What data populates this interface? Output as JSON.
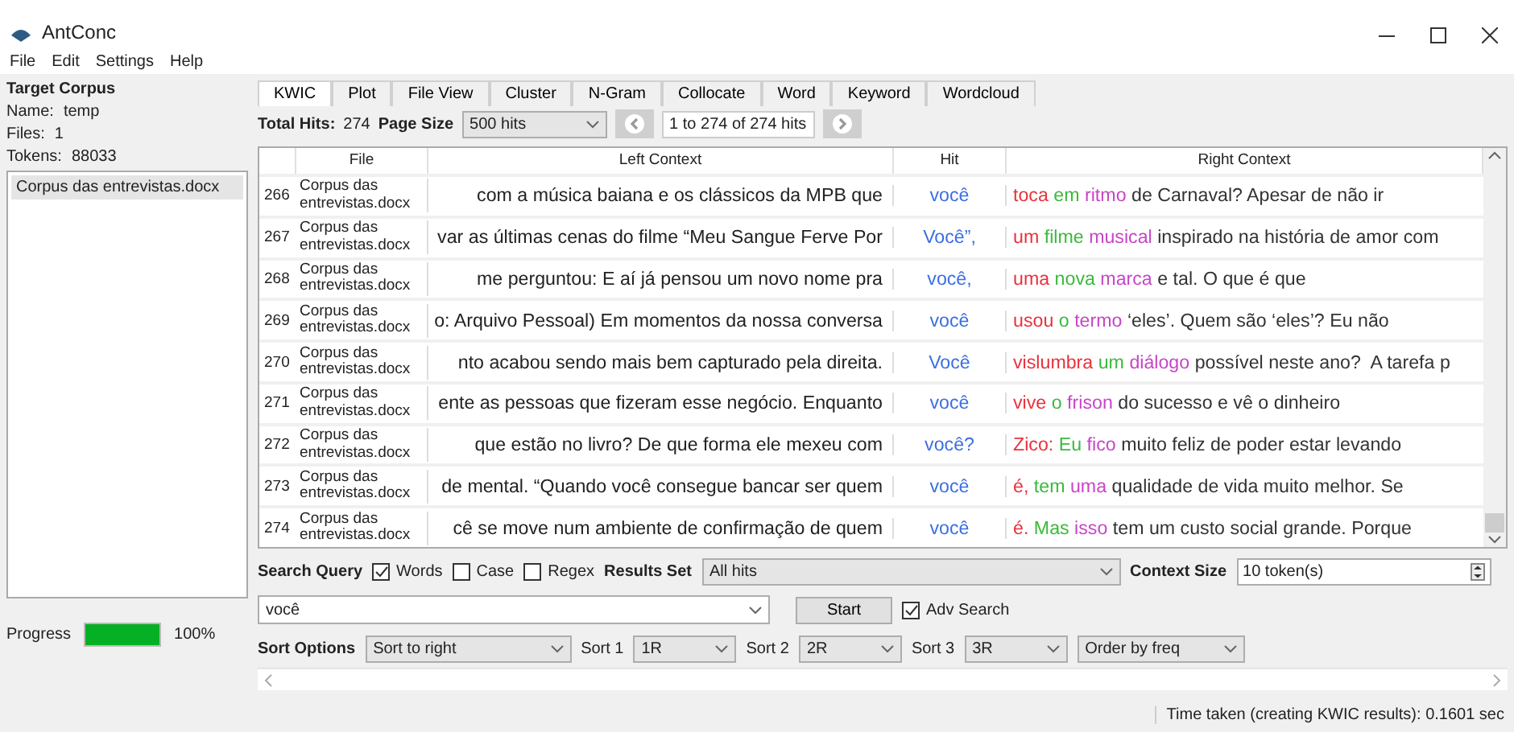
{
  "window": {
    "title": "AntConc"
  },
  "menu": [
    "File",
    "Edit",
    "Settings",
    "Help"
  ],
  "corpus": {
    "heading": "Target Corpus",
    "name_label": "Name:",
    "name": "temp",
    "files_label": "Files:",
    "files": "1",
    "tokens_label": "Tokens:",
    "tokens": "88033",
    "items": [
      {
        "label": "Corpus das entrevistas.docx",
        "selected": true
      }
    ],
    "progress_label": "Progress",
    "progress": {
      "level": 1,
      "reading": "100%"
    }
  },
  "tabs": [
    {
      "label": "KWIC",
      "selected": true
    },
    {
      "label": "Plot",
      "selected": false
    },
    {
      "label": "File View",
      "selected": false
    },
    {
      "label": "Cluster",
      "selected": false
    },
    {
      "label": "N-Gram",
      "selected": false
    },
    {
      "label": "Collocate",
      "selected": false
    },
    {
      "label": "Word",
      "selected": false
    },
    {
      "label": "Keyword",
      "selected": false
    },
    {
      "label": "Wordcloud",
      "selected": false
    }
  ],
  "toolbar": {
    "hits_label": "Total Hits:",
    "hits": "274",
    "page_size_label": "Page Size",
    "page_size": "500 hits",
    "pager": "1 to 274 of 274 hits"
  },
  "table": {
    "columns": [
      "File",
      "Left Context",
      "Hit",
      "Right Context"
    ],
    "rows": [
      {
        "n": "266",
        "file": "Corpus das entrevistas.docx",
        "left": "com a música baiana e os clássicos da MPB que",
        "hit": "você",
        "right": [
          {
            "text": "toca",
            "color": "#e8323c"
          },
          {
            "text": "em",
            "color": "#3cb93c"
          },
          {
            "text": "ritmo",
            "color": "#c845c8"
          },
          {
            "text": "de Carnaval? Apesar de não ir",
            "color": "#333333"
          }
        ]
      },
      {
        "n": "267",
        "file": "Corpus das entrevistas.docx",
        "left": "var as últimas cenas do filme “Meu Sangue Ferve Por",
        "hit": "Você”,",
        "right": [
          {
            "text": "um",
            "color": "#e8323c"
          },
          {
            "text": "filme",
            "color": "#3cb93c"
          },
          {
            "text": "musical",
            "color": "#c845c8"
          },
          {
            "text": "inspirado na história de amor com",
            "color": "#333333"
          }
        ]
      },
      {
        "n": "268",
        "file": "Corpus das entrevistas.docx",
        "left": "me perguntou: E aí já pensou um novo nome pra",
        "hit": "você,",
        "right": [
          {
            "text": "uma",
            "color": "#e8323c"
          },
          {
            "text": "nova",
            "color": "#3cb93c"
          },
          {
            "text": "marca",
            "color": "#c845c8"
          },
          {
            "text": "e tal. O que é que",
            "color": "#333333"
          }
        ]
      },
      {
        "n": "269",
        "file": "Corpus das entrevistas.docx",
        "left": "o: Arquivo Pessoal) Em momentos da nossa conversa",
        "hit": "você",
        "right": [
          {
            "text": "usou",
            "color": "#e8323c"
          },
          {
            "text": "o",
            "color": "#3cb93c"
          },
          {
            "text": "termo",
            "color": "#c845c8"
          },
          {
            "text": "‘eles’. Quem são ‘eles’? Eu não",
            "color": "#333333"
          }
        ]
      },
      {
        "n": "270",
        "file": "Corpus das entrevistas.docx",
        "left": "nto acabou sendo mais bem capturado pela direita.",
        "hit": "Você",
        "right": [
          {
            "text": "vislumbra",
            "color": "#e8323c"
          },
          {
            "text": "um",
            "color": "#3cb93c"
          },
          {
            "text": "diálogo",
            "color": "#c845c8"
          },
          {
            "text": "possível neste ano?  A tarefa p",
            "color": "#333333"
          }
        ]
      },
      {
        "n": "271",
        "file": "Corpus das entrevistas.docx",
        "left": "ente as pessoas que fizeram esse negócio. Enquanto",
        "hit": "você",
        "right": [
          {
            "text": "vive",
            "color": "#e8323c"
          },
          {
            "text": "o",
            "color": "#3cb93c"
          },
          {
            "text": "frison",
            "color": "#c845c8"
          },
          {
            "text": "do sucesso e vê o dinheiro",
            "color": "#333333"
          }
        ]
      },
      {
        "n": "272",
        "file": "Corpus das entrevistas.docx",
        "left": "que estão no livro? De que forma ele mexeu com",
        "hit": "você?",
        "right": [
          {
            "text": "Zico:",
            "color": "#e8323c"
          },
          {
            "text": "Eu",
            "color": "#3cb93c"
          },
          {
            "text": "fico",
            "color": "#c845c8"
          },
          {
            "text": "muito feliz de poder estar levando",
            "color": "#333333"
          }
        ]
      },
      {
        "n": "273",
        "file": "Corpus das entrevistas.docx",
        "left": "de mental. “Quando você consegue bancar ser quem",
        "hit": "você",
        "right": [
          {
            "text": "é,",
            "color": "#e8323c"
          },
          {
            "text": "tem",
            "color": "#3cb93c"
          },
          {
            "text": "uma",
            "color": "#c845c8"
          },
          {
            "text": "qualidade de vida muito melhor. Se",
            "color": "#333333"
          }
        ]
      },
      {
        "n": "274",
        "file": "Corpus das entrevistas.docx",
        "left": "cê se move num ambiente de confirmação de quem",
        "hit": "você",
        "right": [
          {
            "text": "é.",
            "color": "#e8323c"
          },
          {
            "text": "Mas",
            "color": "#3cb93c"
          },
          {
            "text": "isso",
            "color": "#c845c8"
          },
          {
            "text": "tem um custo social grande. Porque",
            "color": "#333333"
          }
        ]
      }
    ]
  },
  "search": {
    "label": "Search Query",
    "options": [
      {
        "label": "Words",
        "checked": true
      },
      {
        "label": "Case",
        "checked": false
      },
      {
        "label": "Regex",
        "checked": false
      }
    ],
    "results_label": "Results Set",
    "results": "All hits",
    "context_label": "Context Size",
    "context": "10 token(s)",
    "query": "você",
    "start": "Start",
    "adv": {
      "label": "Adv Search",
      "checked": true
    }
  },
  "sort": {
    "label": "Sort Options",
    "mode": "Sort to right",
    "levels": [
      {
        "label": "Sort 1",
        "value": "1R"
      },
      {
        "label": "Sort 2",
        "value": "2R"
      },
      {
        "label": "Sort 3",
        "value": "3R"
      }
    ],
    "order": "Order by freq"
  },
  "status_bar": "Time taken (creating KWIC results):  0.1601 sec"
}
